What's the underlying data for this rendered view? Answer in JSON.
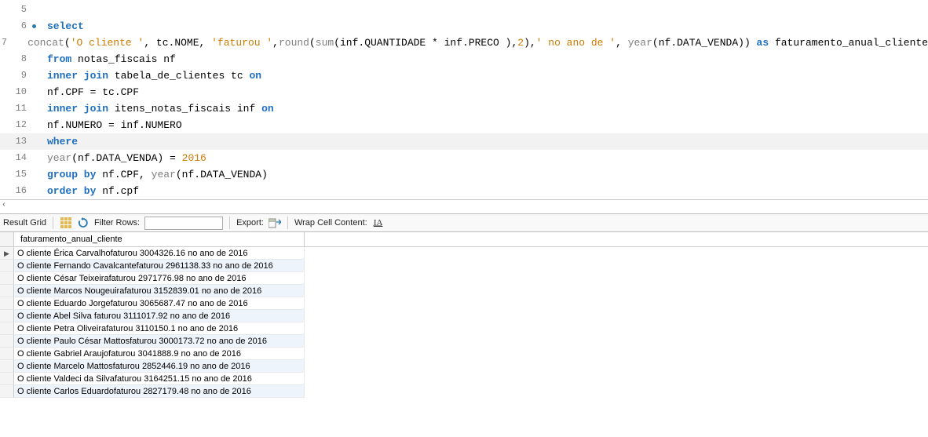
{
  "editor": {
    "lines": [
      {
        "num": 5,
        "marker": false,
        "highlight": false,
        "tokens": []
      },
      {
        "num": 6,
        "marker": true,
        "highlight": false,
        "tokens": [
          {
            "t": "select",
            "c": "kw"
          }
        ]
      },
      {
        "num": 7,
        "marker": false,
        "highlight": false,
        "tokens": [
          {
            "t": "concat",
            "c": "fn"
          },
          {
            "t": "(",
            "c": ""
          },
          {
            "t": "'O cliente '",
            "c": "str"
          },
          {
            "t": ", tc.NOME, ",
            "c": ""
          },
          {
            "t": "'faturou '",
            "c": "str"
          },
          {
            "t": ",",
            "c": ""
          },
          {
            "t": "round",
            "c": "fn"
          },
          {
            "t": "(",
            "c": ""
          },
          {
            "t": "sum",
            "c": "fn"
          },
          {
            "t": "(inf.QUANTIDADE * inf.PRECO ),",
            "c": ""
          },
          {
            "t": "2",
            "c": "num"
          },
          {
            "t": "),",
            "c": ""
          },
          {
            "t": "' no ano de '",
            "c": "str"
          },
          {
            "t": ", ",
            "c": ""
          },
          {
            "t": "year",
            "c": "fn"
          },
          {
            "t": "(nf.DATA_VENDA)) ",
            "c": ""
          },
          {
            "t": "as",
            "c": "kw"
          },
          {
            "t": " faturamento_anual_cliente",
            "c": ""
          }
        ]
      },
      {
        "num": 8,
        "marker": false,
        "highlight": false,
        "tokens": [
          {
            "t": "from",
            "c": "kw"
          },
          {
            "t": " notas_fiscais nf",
            "c": ""
          }
        ]
      },
      {
        "num": 9,
        "marker": false,
        "highlight": false,
        "tokens": [
          {
            "t": "inner join",
            "c": "kw"
          },
          {
            "t": " tabela_de_clientes tc ",
            "c": ""
          },
          {
            "t": "on",
            "c": "kw"
          }
        ]
      },
      {
        "num": 10,
        "marker": false,
        "highlight": false,
        "tokens": [
          {
            "t": "nf.CPF = tc.CPF",
            "c": ""
          }
        ]
      },
      {
        "num": 11,
        "marker": false,
        "highlight": false,
        "tokens": [
          {
            "t": "inner join",
            "c": "kw"
          },
          {
            "t": " itens_notas_fiscais inf ",
            "c": ""
          },
          {
            "t": "on",
            "c": "kw"
          }
        ]
      },
      {
        "num": 12,
        "marker": false,
        "highlight": false,
        "tokens": [
          {
            "t": "nf.NUMERO = inf.NUMERO",
            "c": ""
          }
        ]
      },
      {
        "num": 13,
        "marker": false,
        "highlight": true,
        "tokens": [
          {
            "t": "where",
            "c": "kw"
          }
        ]
      },
      {
        "num": 14,
        "marker": false,
        "highlight": false,
        "tokens": [
          {
            "t": "year",
            "c": "fn"
          },
          {
            "t": "(nf.DATA_VENDA) = ",
            "c": ""
          },
          {
            "t": "2016",
            "c": "num"
          }
        ]
      },
      {
        "num": 15,
        "marker": false,
        "highlight": false,
        "tokens": [
          {
            "t": "group by",
            "c": "kw"
          },
          {
            "t": " nf.CPF, ",
            "c": ""
          },
          {
            "t": "year",
            "c": "fn"
          },
          {
            "t": "(nf.DATA_VENDA)",
            "c": ""
          }
        ]
      },
      {
        "num": 16,
        "marker": false,
        "highlight": false,
        "tokens": [
          {
            "t": "order by",
            "c": "kw"
          },
          {
            "t": " nf.cpf",
            "c": ""
          }
        ]
      }
    ]
  },
  "toolbar": {
    "result_grid_label": "Result Grid",
    "filter_label": "Filter Rows:",
    "filter_value": "",
    "export_label": "Export:",
    "wrap_label": "Wrap Cell Content:",
    "wrap_glyph": "I̲A̲"
  },
  "grid": {
    "column_header": "faturamento_anual_cliente",
    "rows": [
      "O cliente Érica Carvalhofaturou 3004326.16 no ano de 2016",
      "O cliente Fernando Cavalcantefaturou 2961138.33 no ano de 2016",
      "O cliente César Teixeirafaturou 2971776.98 no ano de 2016",
      "O cliente Marcos Nougeuirafaturou 3152839.01 no ano de 2016",
      "O cliente Eduardo Jorgefaturou 3065687.47 no ano de 2016",
      "O cliente Abel Silva faturou 3111017.92 no ano de 2016",
      "O cliente Petra Oliveirafaturou 3110150.1 no ano de 2016",
      "O cliente Paulo César Mattosfaturou 3000173.72 no ano de 2016",
      "O cliente Gabriel Araujofaturou 3041888.9 no ano de 2016",
      "O cliente Marcelo Mattosfaturou 2852446.19 no ano de 2016",
      "O cliente Valdeci da Silvafaturou 3164251.15 no ano de 2016",
      "O cliente Carlos Eduardofaturou 2827179.48 no ano de 2016"
    ]
  }
}
